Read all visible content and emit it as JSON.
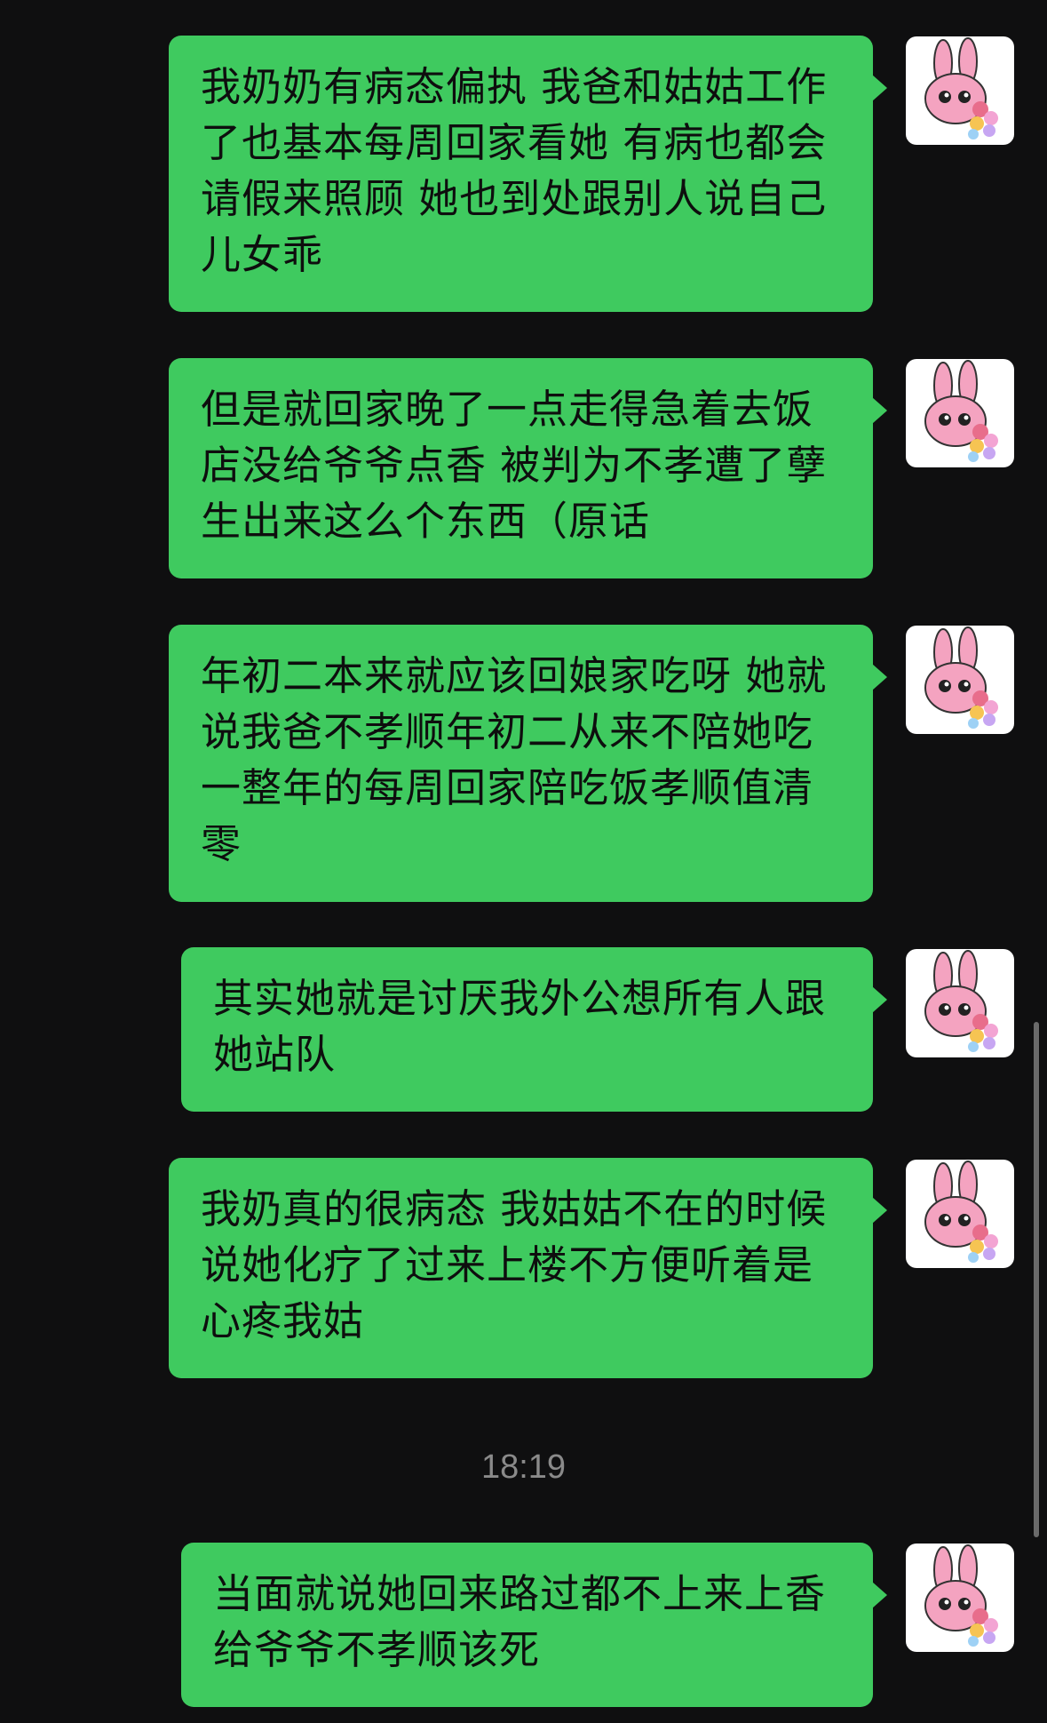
{
  "messages": [
    {
      "text": "我奶奶有病态偏执 我爸和姑姑工作了也基本每周回家看她 有病也都会请假来照顾 她也到处跟别人说自己儿女乖"
    },
    {
      "text": "但是就回家晚了一点走得急着去饭店没给爷爷点香 被判为不孝遭了孽生出来这么个东西（原话"
    },
    {
      "text": "年初二本来就应该回娘家吃呀 她就说我爸不孝顺年初二从来不陪她吃 一整年的每周回家陪吃饭孝顺值清零"
    },
    {
      "text": "其实她就是讨厌我外公想所有人跟她站队"
    },
    {
      "text": "我奶真的很病态 我姑姑不在的时候说她化疗了过来上楼不方便听着是心疼我姑"
    },
    {
      "text": "当面就说她回来路过都不上来上香给爷爷不孝顺该死"
    }
  ],
  "timestamp": "18:19",
  "colors": {
    "background": "#0f0f10",
    "bubble": "#3fca5f",
    "timestamp": "#8a8a8a"
  },
  "avatar_icon": "pink-bunny-sticker-avatar"
}
